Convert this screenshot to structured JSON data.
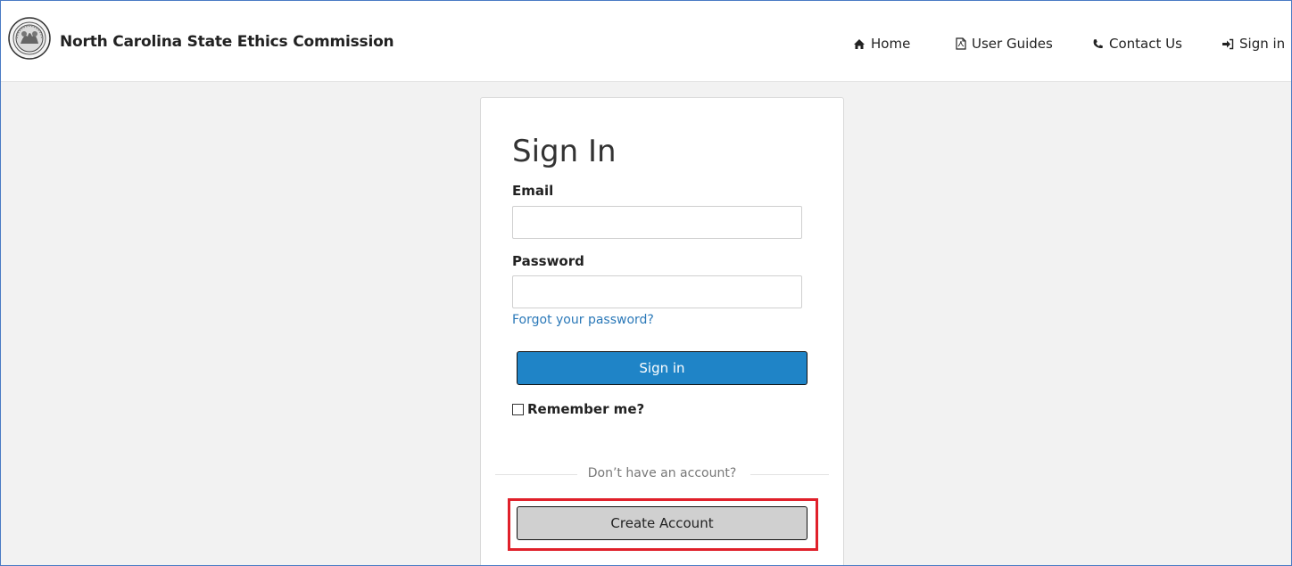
{
  "header": {
    "brand": "North Carolina State Ethics Commission",
    "nav": [
      {
        "label": "Home",
        "icon": "home-icon"
      },
      {
        "label": "User Guides",
        "icon": "pdf-file-icon"
      },
      {
        "label": "Contact Us",
        "icon": "phone-icon"
      },
      {
        "label": "Sign in",
        "icon": "sign-in-icon"
      }
    ]
  },
  "form": {
    "title": "Sign In",
    "email_label": "Email",
    "email_value": "",
    "password_label": "Password",
    "password_value": "",
    "forgot_link": "Forgot your password?",
    "signin_button": "Sign in",
    "remember_label": "Remember me?",
    "remember_checked": false,
    "divider_text": "Don’t have an account?",
    "create_account_button": "Create Account"
  },
  "colors": {
    "primary_button": "#1f84c7",
    "link": "#2a78b8",
    "highlight": "#e0202a",
    "page_background": "#f2f2f2"
  }
}
